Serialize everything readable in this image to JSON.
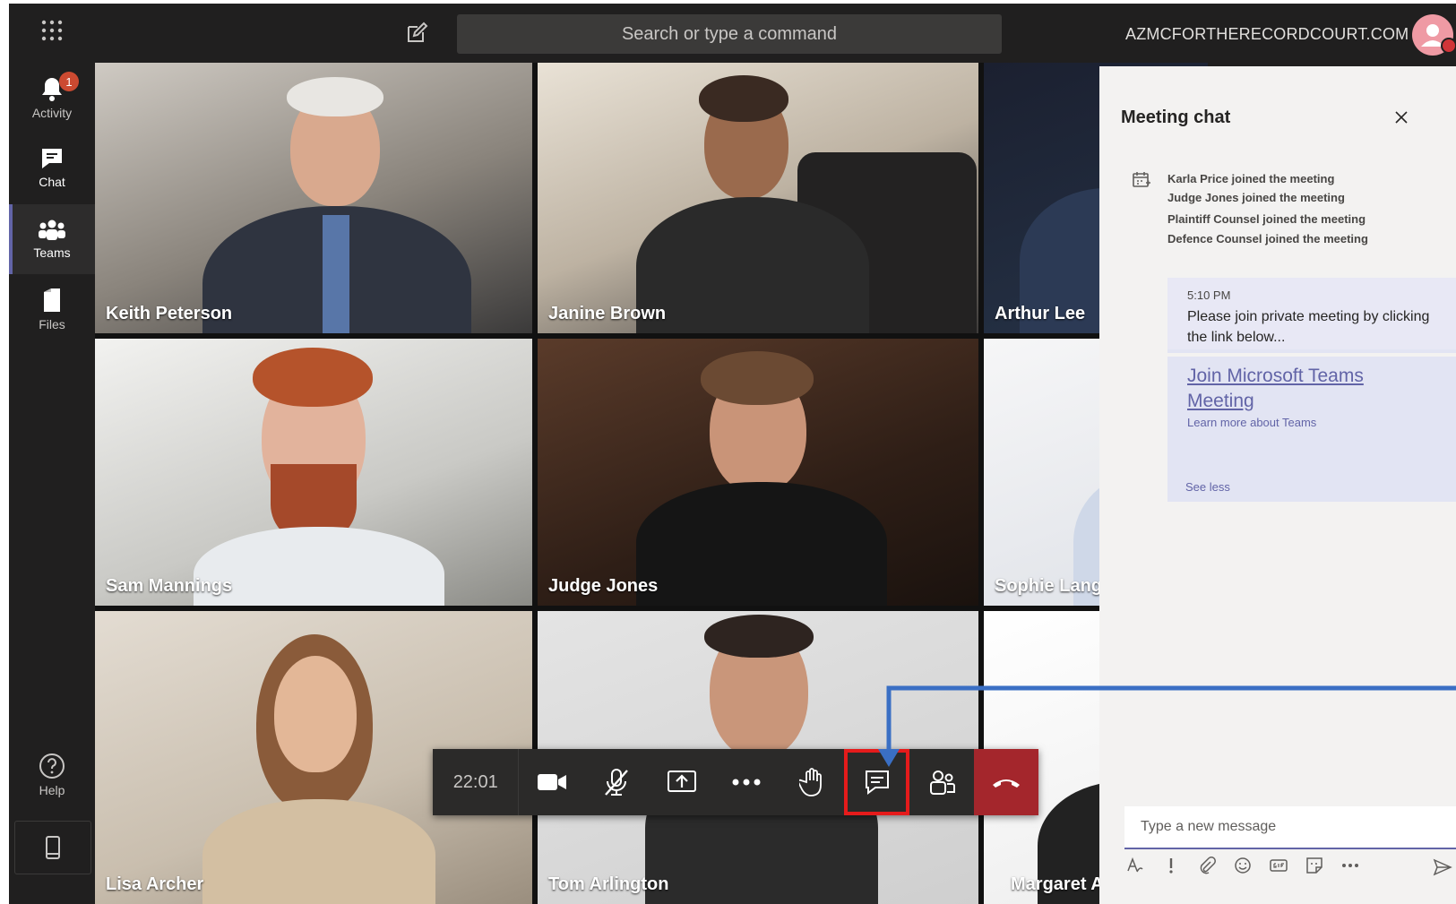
{
  "topbar": {
    "search_placeholder": "Search or type a command",
    "tenant": "AZMCFORTHERECORDCOURT.COM"
  },
  "rail": {
    "items": [
      {
        "label": "Activity",
        "badge": "1"
      },
      {
        "label": "Chat"
      },
      {
        "label": "Teams"
      },
      {
        "label": "Files"
      },
      {
        "label": "Help"
      }
    ]
  },
  "participants": [
    {
      "name": "Keith Peterson"
    },
    {
      "name": "Janine Brown"
    },
    {
      "name": "Arthur Lee"
    },
    {
      "name": "Sam Mannings"
    },
    {
      "name": "Judge Jones"
    },
    {
      "name": "Sophie Lang"
    },
    {
      "name": "Lisa Archer"
    },
    {
      "name": "Tom Arlington"
    },
    {
      "name": "Margaret All"
    }
  ],
  "controls": {
    "timer": "22:01"
  },
  "chat": {
    "title": "Meeting chat",
    "events": [
      "Karla Price joined the meeting",
      "Judge Jones joined the meeting",
      "Plaintiff Counsel joined the meeting",
      "Defence Counsel joined the meeting"
    ],
    "message": {
      "time": "5:10 PM",
      "text": "Please join private meeting by clicking the link below...",
      "link": "Join Microsoft Teams Meeting",
      "learn_more": "Learn more about Teams",
      "see_less": "See less"
    },
    "composer_placeholder": "Type a new message"
  },
  "colors": {
    "brand": "#6264a7",
    "hangup": "#a4262c",
    "highlight": "#e51b1b",
    "annotation": "#3a6fc4"
  }
}
